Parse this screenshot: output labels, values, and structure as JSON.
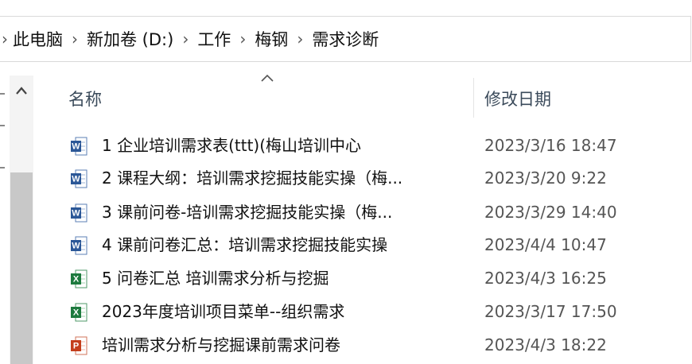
{
  "breadcrumb": [
    "此电脑",
    "新加卷 (D:)",
    "工作",
    "梅钢",
    "需求诊断"
  ],
  "columns": {
    "name": "名称",
    "date_modified": "修改日期"
  },
  "files": [
    {
      "name": "1 企业培训需求表(ttt)(梅山培训中心",
      "date": "2023/3/16 18:47",
      "type": "word"
    },
    {
      "name": "2 课程大纲：培训需求挖掘技能实操（梅...",
      "date": "2023/3/20 9:22",
      "type": "word"
    },
    {
      "name": "3 课前问卷-培训需求挖掘技能实操（梅...",
      "date": "2023/3/29 14:40",
      "type": "word"
    },
    {
      "name": "4 课前问卷汇总：培训需求挖掘技能实操",
      "date": "2023/4/4 10:47",
      "type": "word"
    },
    {
      "name": "5 问卷汇总 培训需求分析与挖掘",
      "date": "2023/4/3 16:25",
      "type": "excel"
    },
    {
      "name": "2023年度培训项目菜单--组织需求",
      "date": "2023/3/17 17:50",
      "type": "excel"
    },
    {
      "name": "培训需求分析与挖掘课前需求问卷",
      "date": "2023/4/3 18:22",
      "type": "powerpoint"
    }
  ],
  "colors": {
    "word": "#2b5797",
    "excel": "#1d7a3e",
    "powerpoint": "#c43e1c"
  }
}
